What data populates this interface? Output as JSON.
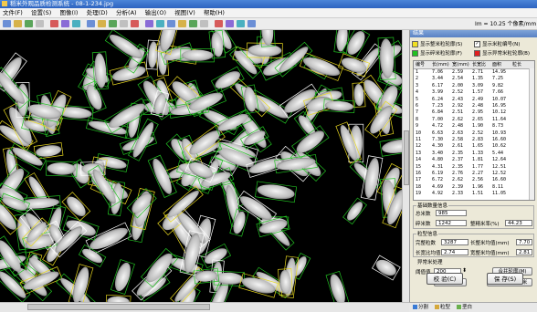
{
  "window": {
    "title": "稻米外观品质检测系统 - 08-1-234.jpg"
  },
  "menu": [
    "文件(F)",
    "设置(S)",
    "图像(I)",
    "处理(D)",
    "分析(A)",
    "输出(O)",
    "视图(V)",
    "帮助(H)"
  ],
  "toolbar": {
    "icons": [
      "new-icon",
      "open-icon",
      "save-icon",
      "print-icon",
      "cut-icon",
      "copy-icon",
      "paste-icon",
      "zoom-in-icon",
      "zoom-out-icon",
      "fit-icon",
      "grid-icon",
      "color-icon",
      "settings-icon",
      "delete-icon",
      "flag-icon",
      "star-icon",
      "star-icon",
      "pointer-icon",
      "undo-icon",
      "redo-icon",
      "help-icon",
      "info-icon"
    ],
    "status": "Im = 10.25 个像素/mm"
  },
  "panel": {
    "title": "结果",
    "legend": {
      "left_top": "显示整米粒轮廓(S)",
      "left_bottom": "显示碎米粒轮廓(F)",
      "right_top": "显示米粒编号(N)",
      "right_bottom": "显示异常米粒轮廓(B)",
      "colors": {
        "whole": "#f0e020",
        "broken": "#20c020",
        "number": "#e03020",
        "abnormal": "#e02020"
      }
    },
    "table": {
      "headers": [
        "编号",
        "长(mm)",
        "宽(mm)",
        "长宽比",
        "面积",
        "粒长"
      ],
      "rows": [
        [
          "1",
          "7.06",
          "2.59",
          "2.71",
          "14.95",
          ""
        ],
        [
          "2",
          "3.44",
          "2.54",
          "1.35",
          "7.25",
          ""
        ],
        [
          "3",
          "6.17",
          "2.00",
          "3.09",
          "9.82",
          ""
        ],
        [
          "4",
          "3.99",
          "2.52",
          "1.57",
          "7.66",
          ""
        ],
        [
          "5",
          "6.24",
          "2.43",
          "2.49",
          "10.07",
          ""
        ],
        [
          "6",
          "7.23",
          "2.92",
          "2.48",
          "16.95",
          ""
        ],
        [
          "7",
          "6.84",
          "2.51",
          "2.95",
          "10.12",
          ""
        ],
        [
          "8",
          "7.00",
          "2.62",
          "2.65",
          "11.64",
          ""
        ],
        [
          "9",
          "4.72",
          "2.48",
          "1.90",
          "8.73",
          ""
        ],
        [
          "10",
          "6.63",
          "2.63",
          "2.52",
          "10.93",
          ""
        ],
        [
          "11",
          "7.30",
          "2.58",
          "2.83",
          "16.60",
          ""
        ],
        [
          "12",
          "4.30",
          "2.61",
          "1.65",
          "10.62",
          ""
        ],
        [
          "13",
          "3.40",
          "2.35",
          "1.33",
          "5.44",
          ""
        ],
        [
          "14",
          "4.80",
          "2.37",
          "1.81",
          "12.64",
          ""
        ],
        [
          "15",
          "4.31",
          "2.35",
          "1.77",
          "12.51",
          ""
        ],
        [
          "16",
          "6.19",
          "2.76",
          "2.27",
          "12.52",
          ""
        ],
        [
          "17",
          "6.72",
          "2.62",
          "2.56",
          "16.60",
          ""
        ],
        [
          "18",
          "4.69",
          "2.39",
          "1.96",
          "8.11",
          ""
        ],
        [
          "19",
          "4.92",
          "2.33",
          "1.51",
          "11.05",
          ""
        ]
      ]
    },
    "basic": {
      "title": "基础数量信息",
      "total_label": "总米数",
      "total_value": "985",
      "broken_label": "碎米数",
      "broken_value": "1242",
      "rate_label": "整精米率(%)",
      "rate_value": "44.23"
    },
    "length": {
      "title": "粒型信息",
      "count_label": "完整粒数",
      "count_value": "3287",
      "avg_len_label": "长整米均值(mm)",
      "avg_len_value": "7.70",
      "ratio_label": "长宽比均值",
      "ratio_value": "2.74",
      "avg_w_label": "宽整米均值(mm)",
      "avg_w_value": "2.81"
    },
    "abnormal": {
      "title": "异常米处理",
      "threshold_label": "阈值值",
      "threshold_value": "200",
      "btn_merge": "合并轮廓(M)",
      "btn_split": "手动分割",
      "btn_manual": "手动编辑异常米"
    },
    "btn_analyze": "校 验(C)",
    "btn_save": "保 存(S)",
    "tabs": [
      "分割",
      "粒型",
      "垩白"
    ]
  }
}
